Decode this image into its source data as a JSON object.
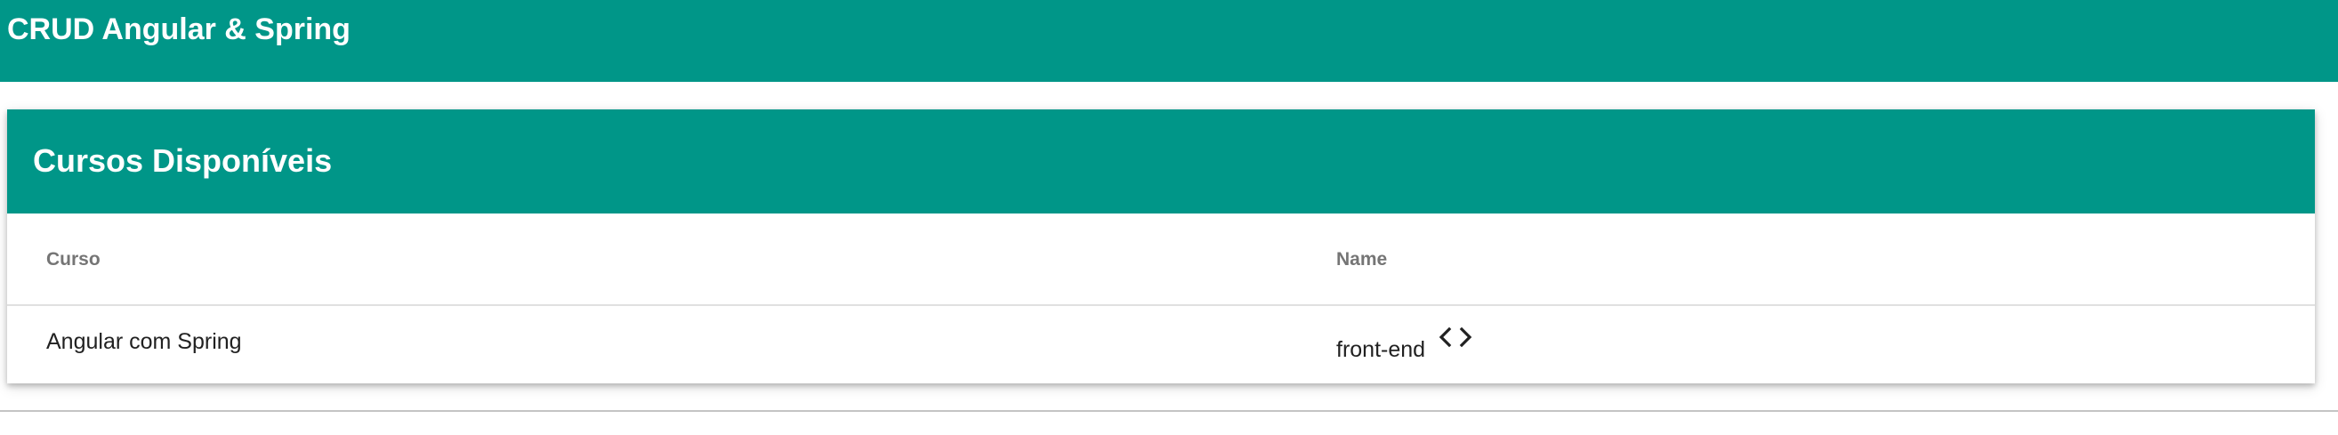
{
  "toolbar": {
    "title": "CRUD Angular & Spring",
    "color": "#009688"
  },
  "card": {
    "title": "Cursos Disponíveis",
    "header_color": "#009688"
  },
  "table": {
    "columns": [
      "Curso",
      "Name"
    ],
    "rows": [
      {
        "curso": "Angular com Spring",
        "name": "front-end",
        "icon": "code-icon"
      }
    ]
  }
}
